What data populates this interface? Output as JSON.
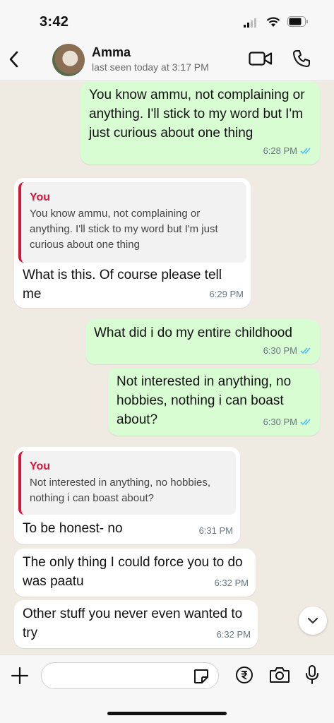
{
  "status_bar": {
    "time": "3:42"
  },
  "header": {
    "contact_name": "Amma",
    "last_seen": "last seen today at 3:17 PM",
    "icons": [
      "back-icon",
      "video-call-icon",
      "voice-call-icon"
    ]
  },
  "messages": [
    {
      "dir": "out",
      "text": "You know ammu, not complaining or anything. I'll stick to my word but I'm just curious about one thing",
      "time": "6:28 PM",
      "read": true
    },
    {
      "dir": "in",
      "quote_name": "You",
      "quote_text": "You know ammu, not complaining or anything. I'll stick to my word but I'm just curious about one thing",
      "text": "What is this. Of course please tell me",
      "time": "6:29 PM"
    },
    {
      "dir": "out",
      "text": "What did i do my entire childhood",
      "time": "6:30 PM",
      "read": true
    },
    {
      "dir": "out",
      "text": "Not interested in anything, no hobbies, nothing i can boast about?",
      "time": "6:30 PM",
      "read": true
    },
    {
      "dir": "in",
      "quote_name": "You",
      "quote_text": "Not interested in anything, no hobbies, nothing i can boast about?",
      "text": "To be honest- no",
      "time": "6:31 PM"
    },
    {
      "dir": "in",
      "text": "The only thing I could force you to do was paatu",
      "time": "6:32 PM"
    },
    {
      "dir": "in",
      "text": "Other stuff you never even wanted to try",
      "time": "6:32 PM"
    }
  ],
  "composer": {
    "placeholder": "",
    "icons": [
      "plus-icon",
      "sticker-icon",
      "rupee-payment-icon",
      "camera-icon",
      "microphone-icon"
    ]
  },
  "colors": {
    "outgoing": "#d9fdd3",
    "incoming": "#ffffff",
    "quote_accent": "#d5163b",
    "read_ticks": "#53bdeb",
    "chat_bg": "#efeae2"
  }
}
